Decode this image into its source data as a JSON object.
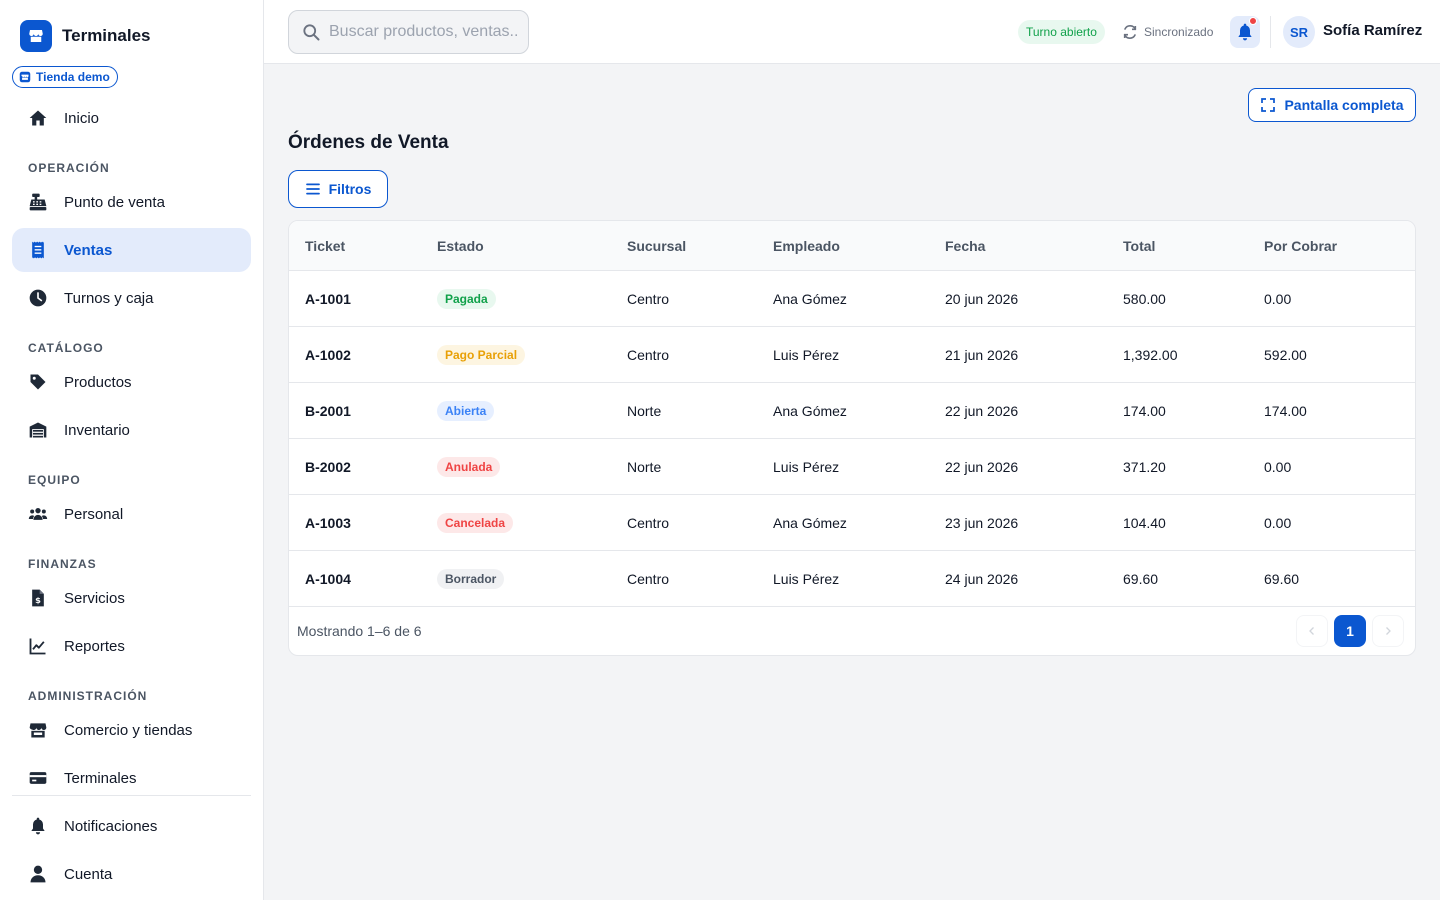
{
  "sidebar": {
    "brand": "Terminales",
    "store_chip": "Tienda demo",
    "home": "Inicio",
    "sections": {
      "operacion": "OPERACIÓN",
      "catalogo": "CATÁLOGO",
      "equipo": "EQUIPO",
      "finanzas": "FINANZAS",
      "administracion": "ADMINISTRACIÓN"
    },
    "items": {
      "pos": "Punto de venta",
      "ventas": "Ventas",
      "turnos": "Turnos y caja",
      "productos": "Productos",
      "inventario": "Inventario",
      "personal": "Personal",
      "servicios": "Servicios",
      "reportes": "Reportes",
      "comercio": "Comercio y tiendas",
      "terminales": "Terminales",
      "notificaciones": "Notificaciones",
      "cuenta": "Cuenta"
    },
    "active_item": "Ventas"
  },
  "topbar": {
    "search_placeholder": "Buscar productos, ventas...",
    "search_value": "",
    "shift_status": "Turno abierto",
    "sync_status": "Sincronizado",
    "user_initials": "SR",
    "user_name": "Sofía Ramírez"
  },
  "main": {
    "fullscreen_label": "Pantalla completa",
    "title": "Órdenes de Venta",
    "filters_label": "Filtros",
    "table": {
      "headers": [
        "Ticket",
        "Estado",
        "Sucursal",
        "Empleado",
        "Fecha",
        "Total",
        "Por Cobrar"
      ],
      "rows": [
        {
          "ticket": "A-1001",
          "estado": "Pagada",
          "sucursal": "Centro",
          "empleado": "Ana Gómez",
          "fecha": "20 jun 2026",
          "total": "580.00",
          "por_cobrar": "0.00"
        },
        {
          "ticket": "A-1002",
          "estado": "Pago Parcial",
          "sucursal": "Centro",
          "empleado": "Luis Pérez",
          "fecha": "21 jun 2026",
          "total": "1,392.00",
          "por_cobrar": "592.00"
        },
        {
          "ticket": "B-2001",
          "estado": "Abierta",
          "sucursal": "Norte",
          "empleado": "Ana Gómez",
          "fecha": "22 jun 2026",
          "total": "174.00",
          "por_cobrar": "174.00"
        },
        {
          "ticket": "B-2002",
          "estado": "Anulada",
          "sucursal": "Norte",
          "empleado": "Luis Pérez",
          "fecha": "22 jun 2026",
          "total": "371.20",
          "por_cobrar": "0.00"
        },
        {
          "ticket": "A-1003",
          "estado": "Cancelada",
          "sucursal": "Centro",
          "empleado": "Ana Gómez",
          "fecha": "23 jun 2026",
          "total": "104.40",
          "por_cobrar": "0.00"
        },
        {
          "ticket": "A-1004",
          "estado": "Borrador",
          "sucursal": "Centro",
          "empleado": "Luis Pérez",
          "fecha": "24 jun 2026",
          "total": "69.60",
          "por_cobrar": "69.60"
        }
      ]
    },
    "footer_text": "Mostrando 1–6 de 6",
    "pagination": {
      "current_page": "1",
      "prev_icon": "chevron-left-icon",
      "next_icon": "chevron-right-icon"
    }
  },
  "colors": {
    "primary": "#0b57d0",
    "active_bg": "#e3ebfb",
    "status": {
      "Pagada": {
        "fg": "#10a14a",
        "bg": "#e8f8ef"
      },
      "Pago Parcial": {
        "fg": "#e8a006",
        "bg": "#fdf5e1"
      },
      "Abierta": {
        "fg": "#3b82f6",
        "bg": "#e6efff"
      },
      "Anulada": {
        "fg": "#ef4444",
        "bg": "#fde8e8"
      },
      "Cancelada": {
        "fg": "#ef4444",
        "bg": "#fde8e8"
      },
      "Borrador": {
        "fg": "#4b5563",
        "bg": "#f0f1f3"
      }
    }
  }
}
